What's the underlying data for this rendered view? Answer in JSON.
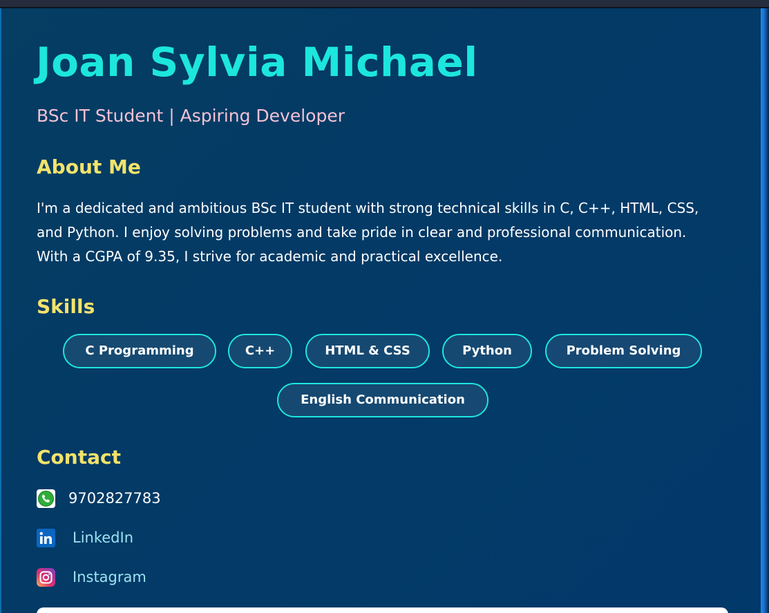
{
  "profile": {
    "name": "Joan Sylvia Michael",
    "tagline": "BSc IT Student | Aspiring Developer"
  },
  "about": {
    "heading": "About Me",
    "text": "I'm a dedicated and ambitious BSc IT student with strong technical skills in C, C++, HTML, CSS, and Python. I enjoy solving problems and take pride in clear and professional communication. With a CGPA of 9.35, I strive for academic and practical excellence."
  },
  "skills": {
    "heading": "Skills",
    "items": [
      "C Programming",
      "C++",
      "HTML & CSS",
      "Python",
      "Problem Solving",
      "English Communication"
    ]
  },
  "contact": {
    "heading": "Contact",
    "phone": {
      "icon": "phone-icon",
      "value": "9702827783"
    },
    "linkedin": {
      "icon": "linkedin-icon",
      "label": "LinkedIn"
    },
    "instagram": {
      "icon": "instagram-icon",
      "label": "Instagram"
    }
  },
  "colors": {
    "name": "#1de6dc",
    "tagline": "#f4c2d4",
    "heading": "#f3e36a",
    "chip_border": "#1de6dc",
    "link": "#9be3f2",
    "background": "#033a66"
  }
}
